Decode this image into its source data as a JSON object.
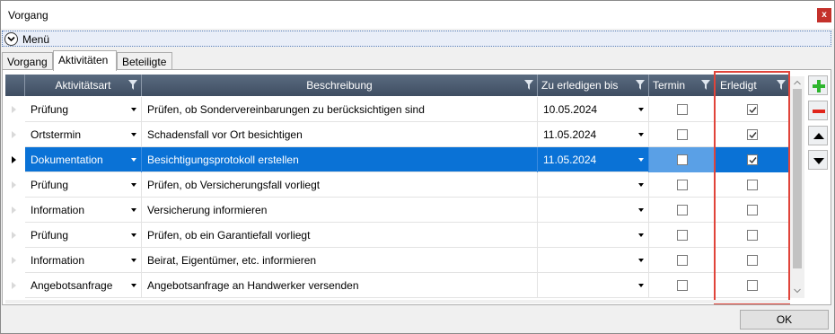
{
  "window": {
    "title": "Vorgang",
    "close_label": "x"
  },
  "menu": {
    "label": "Menü"
  },
  "tabs": [
    {
      "label": "Vorgang",
      "active": false
    },
    {
      "label": "Aktivitäten",
      "active": true
    },
    {
      "label": "Beteiligte",
      "active": false
    }
  ],
  "grid": {
    "columns": {
      "aktivitaetsart": "Aktivitätsart",
      "beschreibung": "Beschreibung",
      "zu_erledigen_bis": "Zu erledigen bis",
      "termin": "Termin",
      "erledigt": "Erledigt"
    },
    "rows": [
      {
        "aktivitaetsart": "Prüfung",
        "beschreibung": "Prüfen, ob Sondervereinbarungen zu berücksichtigen sind",
        "zu_erledigen_bis": "10.05.2024",
        "termin": false,
        "erledigt": true,
        "selected": false
      },
      {
        "aktivitaetsart": "Ortstermin",
        "beschreibung": "Schadensfall vor Ort besichtigen",
        "zu_erledigen_bis": "11.05.2024",
        "termin": false,
        "erledigt": true,
        "selected": false
      },
      {
        "aktivitaetsart": "Dokumentation",
        "beschreibung": "Besichtigungsprotokoll erstellen",
        "zu_erledigen_bis": "11.05.2024",
        "termin": false,
        "erledigt": true,
        "selected": true
      },
      {
        "aktivitaetsart": "Prüfung",
        "beschreibung": "Prüfen, ob Versicherungsfall vorliegt",
        "zu_erledigen_bis": "",
        "termin": false,
        "erledigt": false,
        "selected": false
      },
      {
        "aktivitaetsart": "Information",
        "beschreibung": "Versicherung informieren",
        "zu_erledigen_bis": "",
        "termin": false,
        "erledigt": false,
        "selected": false
      },
      {
        "aktivitaetsart": "Prüfung",
        "beschreibung": "Prüfen, ob ein Garantiefall vorliegt",
        "zu_erledigen_bis": "",
        "termin": false,
        "erledigt": false,
        "selected": false
      },
      {
        "aktivitaetsart": "Information",
        "beschreibung": "Beirat, Eigentümer, etc. informieren",
        "zu_erledigen_bis": "",
        "termin": false,
        "erledigt": false,
        "selected": false
      },
      {
        "aktivitaetsart": "Angebotsanfrage",
        "beschreibung": "Angebotsanfrage an Handwerker versenden",
        "zu_erledigen_bis": "",
        "termin": false,
        "erledigt": false,
        "selected": false
      }
    ]
  },
  "side_buttons": [
    {
      "icon": "plus-icon",
      "color": "#2db52d"
    },
    {
      "icon": "minus-icon",
      "color": "#e0251b"
    },
    {
      "icon": "move-up-icon",
      "color": "#000000"
    },
    {
      "icon": "move-down-icon",
      "color": "#000000"
    }
  ],
  "highlight_color": "#e0443a",
  "ok_label": "OK"
}
